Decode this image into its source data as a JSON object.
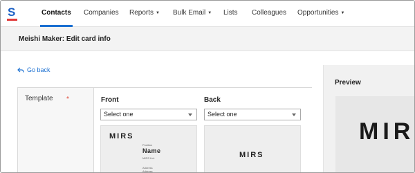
{
  "nav": {
    "items": [
      {
        "label": "Contacts",
        "active": true,
        "dropdown": false
      },
      {
        "label": "Companies",
        "active": false,
        "dropdown": false
      },
      {
        "label": "Reports",
        "active": false,
        "dropdown": true
      },
      {
        "label": "Bulk Email",
        "active": false,
        "dropdown": true
      },
      {
        "label": "Lists",
        "active": false,
        "dropdown": false
      },
      {
        "label": "Colleagues",
        "active": false,
        "dropdown": false
      },
      {
        "label": "Opportunities",
        "active": false,
        "dropdown": true
      }
    ],
    "caret": "▼"
  },
  "page": {
    "title": "Meishi Maker: Edit card info",
    "go_back": "Go back"
  },
  "form": {
    "template_label": "Template",
    "required_mark": "*",
    "front": {
      "title": "Front",
      "select_value": "Select one"
    },
    "back": {
      "title": "Back",
      "select_value": "Select one"
    }
  },
  "card_front": {
    "brand": "MIRS",
    "position_label": "Position",
    "name": "Name",
    "company": "MIRS Ltd.",
    "address_label": "Address",
    "address_label_2": "Address"
  },
  "card_back": {
    "brand": "MIRS"
  },
  "preview": {
    "title": "Preview",
    "brand": "MIRS"
  },
  "colors": {
    "accent": "#1a6fd1",
    "required": "#e04a3a",
    "logo_red": "#e03a3a",
    "logo_blue": "#1a5fc4"
  }
}
